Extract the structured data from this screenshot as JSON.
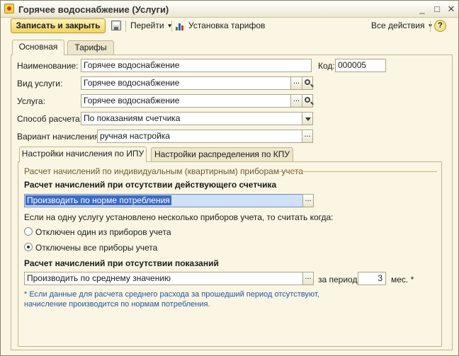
{
  "window": {
    "title": "Горячее водоснабжение (Услуги)",
    "minimize": "_",
    "maximize": "□",
    "close": "✕"
  },
  "toolbar": {
    "save_close_label": "Записать и закрыть",
    "goto_label": "Перейти",
    "tariffs_label": "Установка тарифов",
    "all_actions_label": "Все действия",
    "help_label": "?"
  },
  "tabs": {
    "main": "Основная",
    "tariffs": "Тарифы"
  },
  "form": {
    "name_label": "Наименование:",
    "name_value": "Горячее водоснабжение",
    "code_label": "Код:",
    "code_value": "000005",
    "service_type_label": "Вид услуги:",
    "service_type_value": "Горячее водоснабжение",
    "service_label": "Услуга:",
    "service_value": "Горячее водоснабжение",
    "calc_method_label": "Способ расчета:",
    "calc_method_value": "По показаниям счетчика",
    "accrual_variant_label": "Вариант начисления:",
    "accrual_variant_value": "ручная настройка",
    "ellipsis": "..."
  },
  "subtabs": {
    "ipu": "Настройки начисления по ИПУ",
    "kpu": "Настройки распределения по КПУ"
  },
  "ipu_panel": {
    "group_title": "Расчет начислений по индивидуальным (квартирным) приборам учета",
    "no_meter_title": "Расчет начислений при отсутствии действующего счетчика",
    "no_meter_value": "Производить по норме потребления",
    "multi_meter_text": "Если на одну услугу установлено несколько приборов учета, то считать когда:",
    "radio_one_label": "Отключен один из приборов учета",
    "radio_all_label": "Отключены все приборы учета",
    "radio_selected": "all",
    "no_readings_title": "Расчет начислений при отсутствии показаний",
    "no_readings_value": "Производить по среднему значению",
    "period_label": "за период:",
    "period_value": "3",
    "period_unit": "мес. *",
    "note_line1": "* Если данные для расчета среднего расхода за прошедший период отсутствуют,",
    "note_line2": "начисление производится по нормам потребления."
  }
}
